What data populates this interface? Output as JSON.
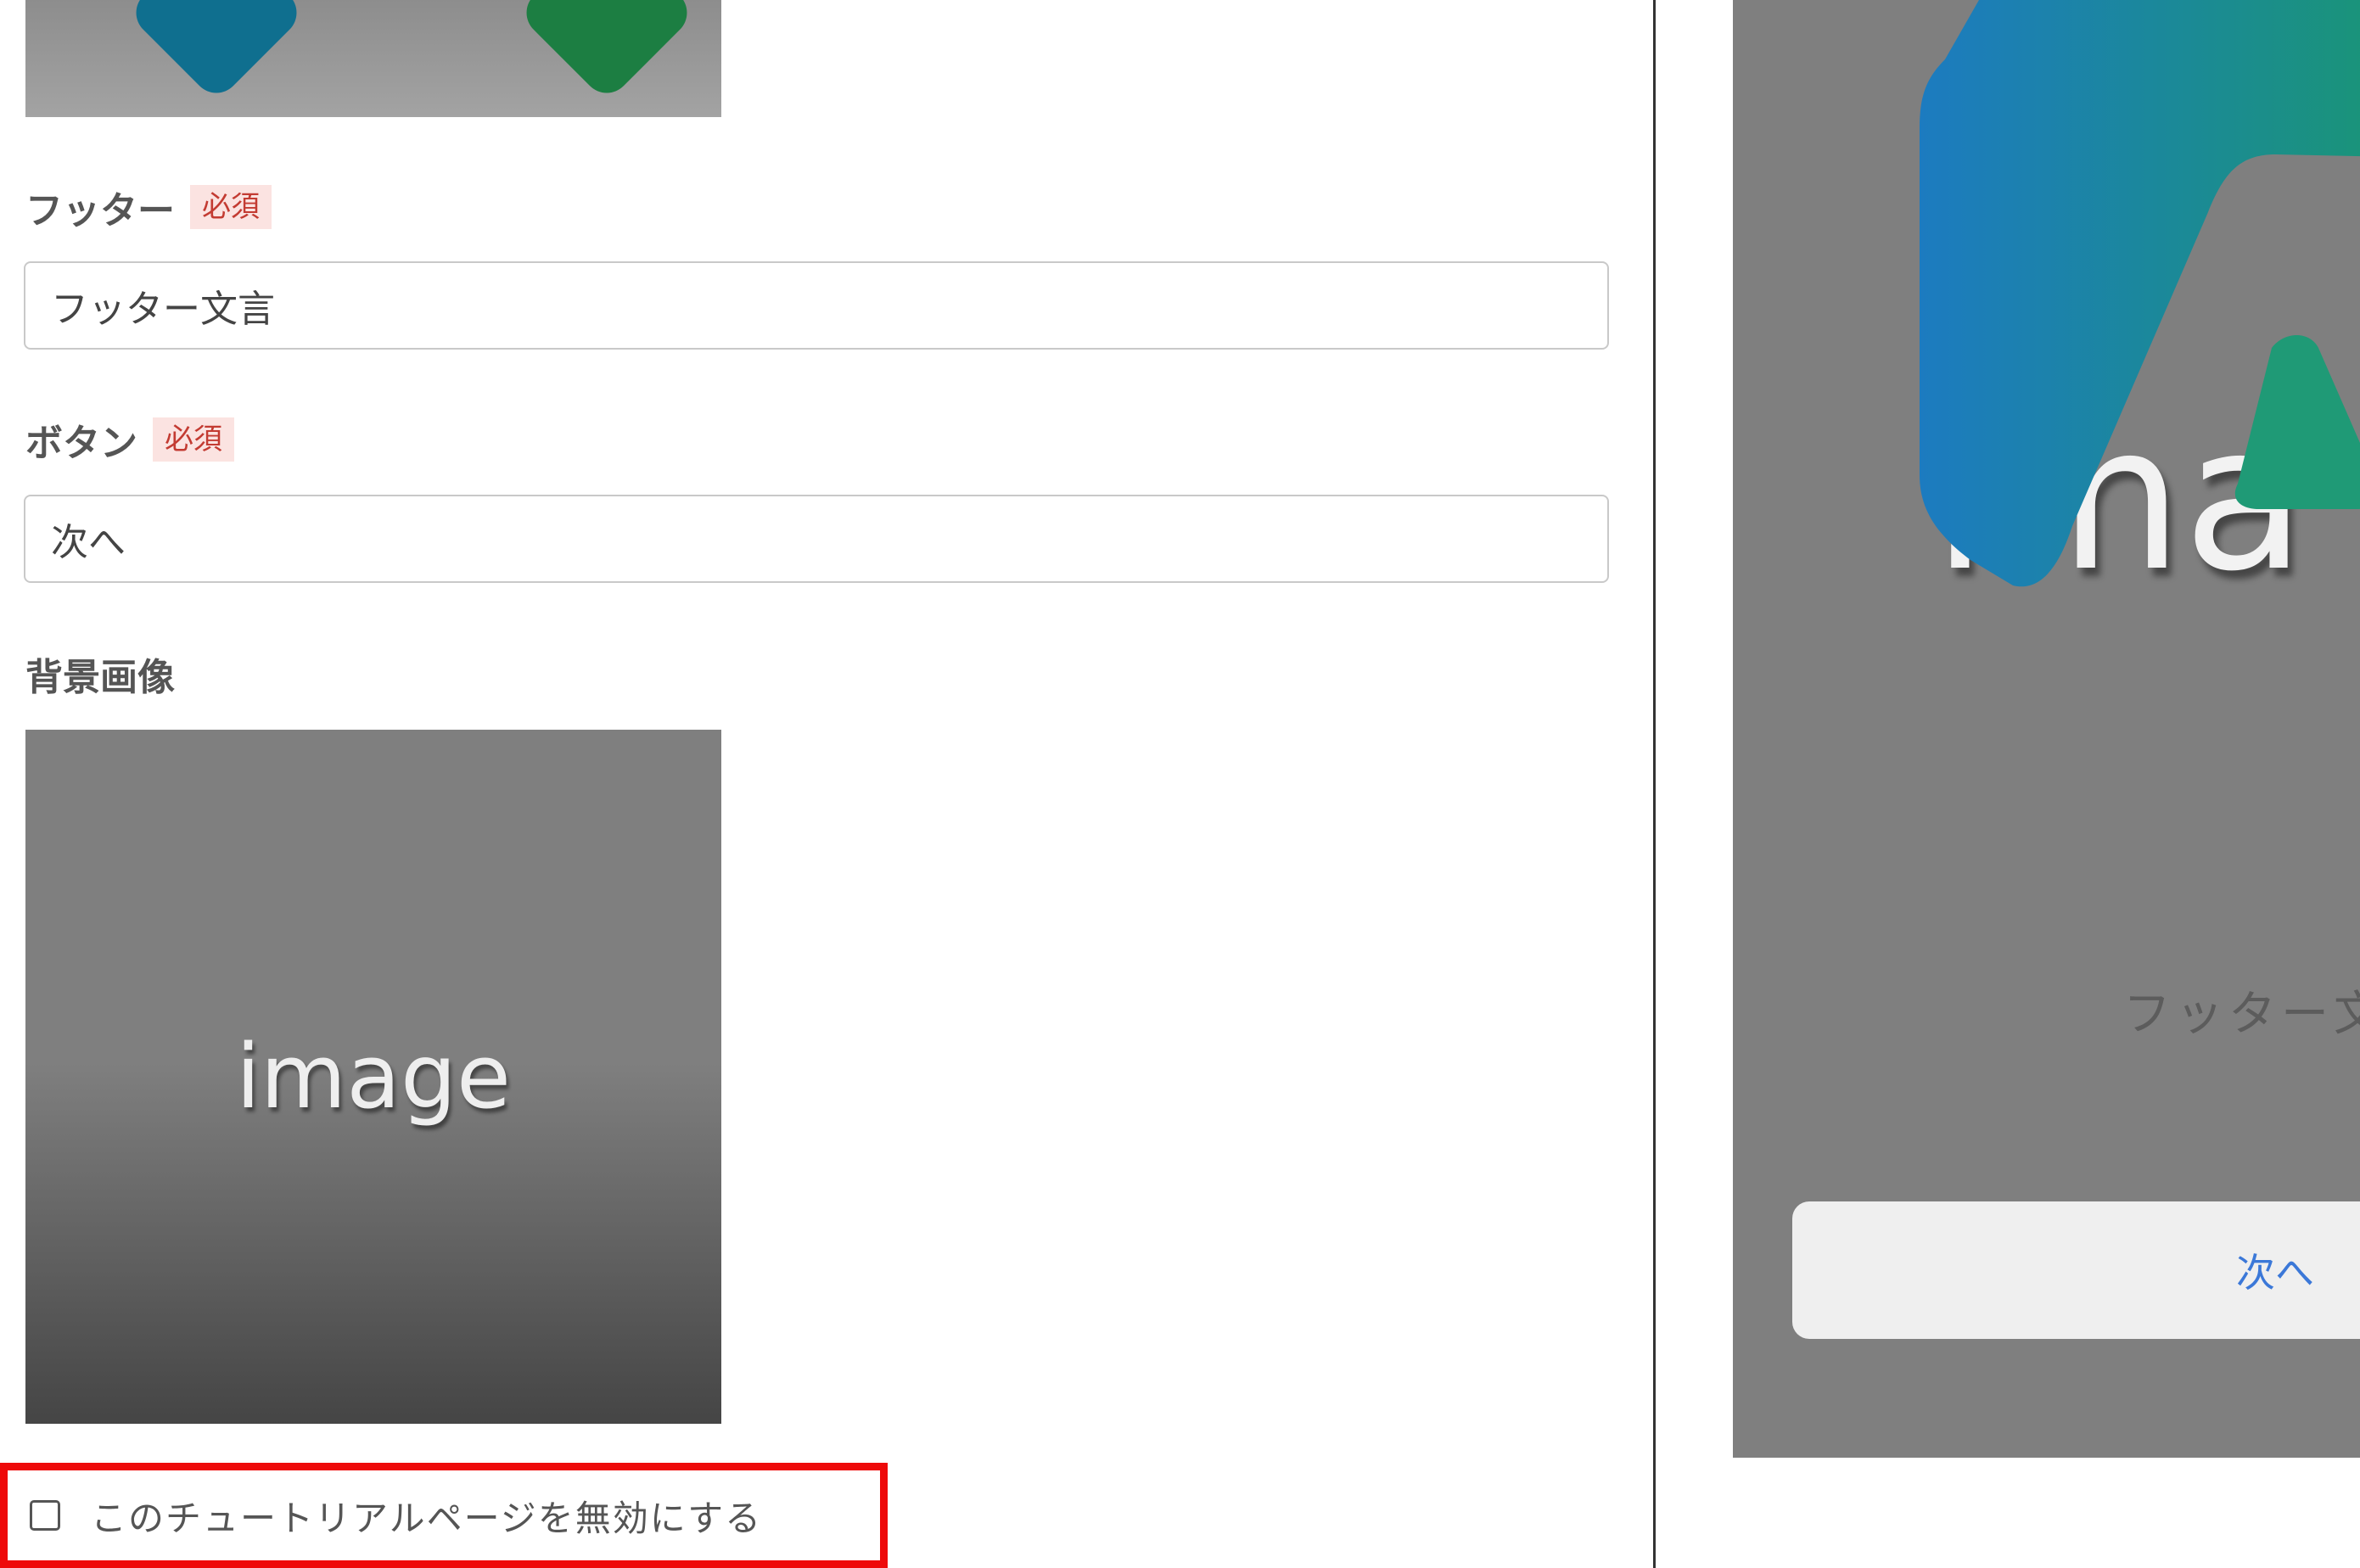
{
  "editor": {
    "footer": {
      "label": "フッター",
      "required": "必須",
      "value": "フッター文言"
    },
    "button": {
      "label": "ボタン",
      "required": "必須",
      "value": "次へ"
    },
    "background_image": {
      "label": "背景画像",
      "thumbnail_text": "image"
    },
    "disable_checkbox": {
      "label": "このチュートリアルページを無効にする",
      "checked": false
    }
  },
  "preview": {
    "image_text": "ima",
    "footer_text": "フッター文",
    "button_label": "次へ"
  },
  "colors": {
    "required_badge_bg": "#fbe3e1",
    "required_badge_text": "#c33b32",
    "highlight_border": "#ee0a0a",
    "preview_button_text": "#3b78d8",
    "logo_gradient_start": "#1c7bc0",
    "logo_gradient_end": "#1a9a68"
  }
}
